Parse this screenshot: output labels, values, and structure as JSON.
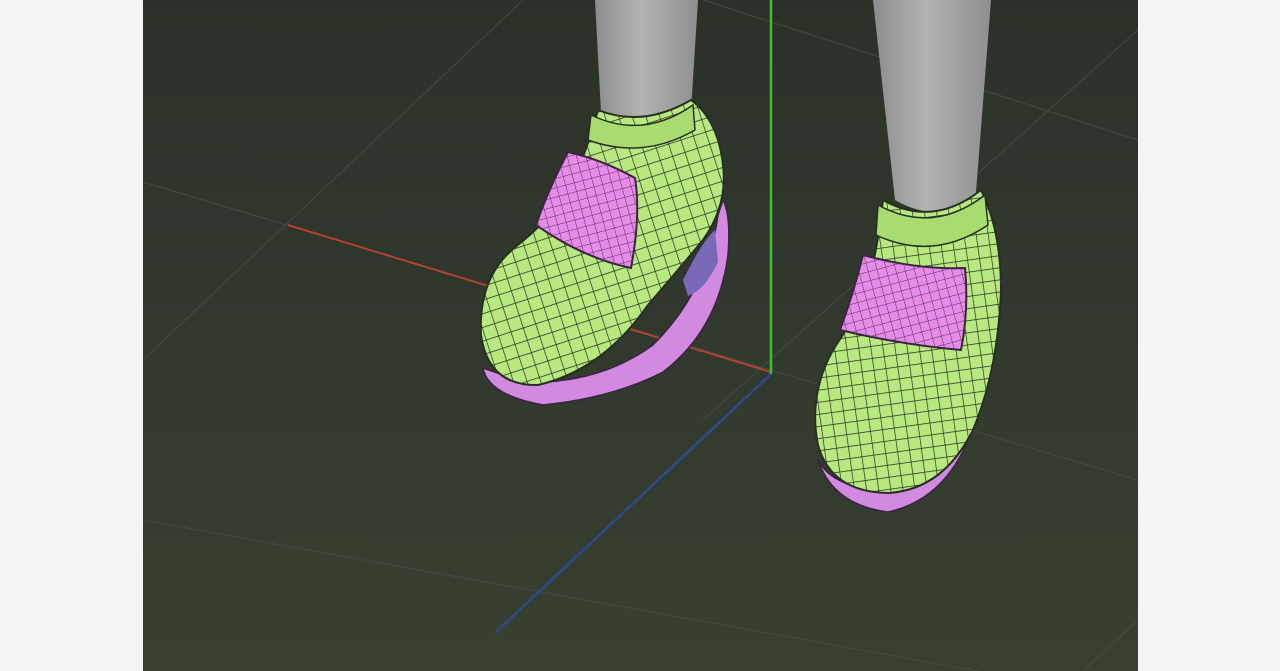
{
  "viewport": {
    "view": "perspective",
    "grid": true,
    "axes": {
      "x_color": "#b4402f",
      "y_color": "#3fbf2f",
      "z_color": "#2f4a8c"
    },
    "mesh": {
      "wireframe": true,
      "shoe_color": "#b8e880",
      "strap_color": "#e48ce8",
      "sole_color": "#d28ae0",
      "leg_color": "#a9a9a9",
      "wire_color": "#263020"
    }
  }
}
